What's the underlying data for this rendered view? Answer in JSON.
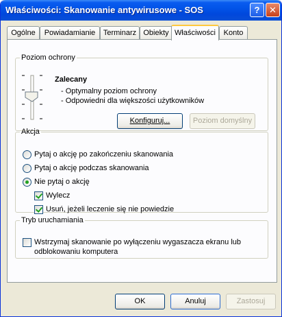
{
  "window": {
    "title": "Właściwości: Skanowanie antywirusowe - SOS",
    "help_glyph": "?",
    "close_glyph": "✕"
  },
  "tabs": [
    {
      "label": "Ogólne"
    },
    {
      "label": "Powiadamianie"
    },
    {
      "label": "Terminarz"
    },
    {
      "label": "Obiekty"
    },
    {
      "label": "Właściwości"
    },
    {
      "label": "Konto"
    }
  ],
  "active_tab": "Właściwości",
  "protection": {
    "group_label": "Poziom ochrony",
    "level_title": "Zalecany",
    "bullets": [
      "- Optymalny poziom ochrony",
      "- Odpowiedni dla większości użytkowników"
    ],
    "configure_button": "Konfiguruj...",
    "default_button": "Poziom domyślny"
  },
  "action": {
    "group_label": "Akcja",
    "options": [
      "Pytaj o akcję po zakończeniu skanowania",
      "Pytaj o akcję podczas skanowania",
      "Nie pytaj o akcję"
    ],
    "selected": "Nie pytaj o akcję",
    "cure_label": "Wylecz",
    "cure_checked": true,
    "delete_label": "Usuń, jeżeli leczenie się nie powiedzie",
    "delete_checked": true
  },
  "run_mode": {
    "group_label": "Tryb uruchamiania",
    "stop_label_line1": "Wstrzymaj skanowanie po wyłączeniu wygaszacza ekranu lub",
    "stop_label_line2": "odblokowaniu komputera",
    "stop_checked": false
  },
  "footer": {
    "ok": "OK",
    "cancel": "Anuluj",
    "apply": "Zastosuj"
  },
  "colors": {
    "titlebar": "#0054e3",
    "face": "#ece9d8",
    "tab_highlight": "#ffc83c",
    "check_mark": "#21a121"
  }
}
